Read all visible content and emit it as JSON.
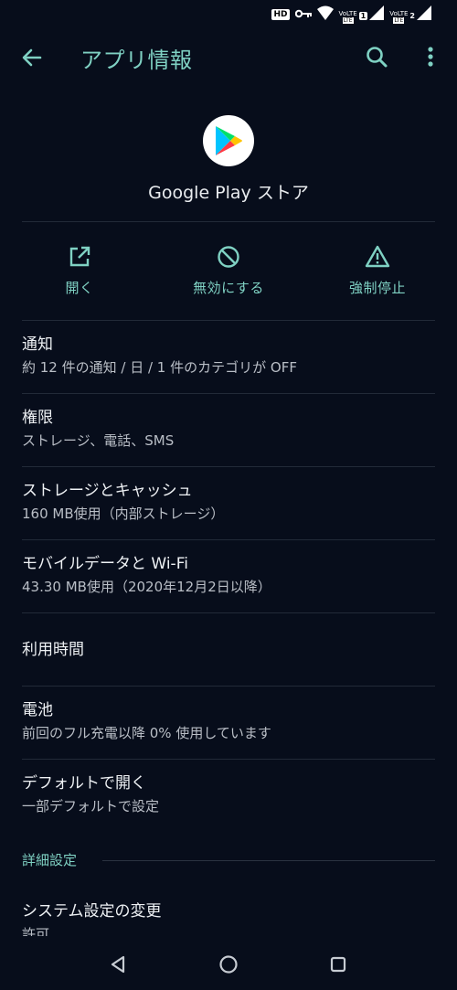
{
  "status_bar": {
    "icons": [
      "hd-badge-icon",
      "vpn-key-icon",
      "wifi-icon",
      "volte-lte-icon",
      "signal-icon",
      "volte-lte-icon",
      "signal-icon"
    ],
    "sim1": "1",
    "sim2": "2",
    "volte": "VoLTE",
    "lte": "LTE",
    "hd_badge": "HD"
  },
  "app_bar": {
    "title": "アプリ情報",
    "back_icon": "arrow-back-icon",
    "search_icon": "search-icon",
    "more_icon": "more-vert-icon"
  },
  "app": {
    "name": "Google Play ストア",
    "icon": "google-play-icon"
  },
  "actions": [
    {
      "label": "開く",
      "icon": "open-external-icon"
    },
    {
      "label": "無効にする",
      "icon": "block-icon"
    },
    {
      "label": "強制停止",
      "icon": "warning-icon"
    }
  ],
  "settings": [
    {
      "title": "通知",
      "summary": "約 12 件の通知 / 日 / 1 件のカテゴリが OFF"
    },
    {
      "title": "権限",
      "summary": "ストレージ、電話、SMS"
    },
    {
      "title": "ストレージとキャッシュ",
      "summary": "160 MB使用（内部ストレージ）"
    },
    {
      "title": "モバイルデータと Wi-Fi",
      "summary": "43.30 MB使用（2020年12月2日以降）"
    },
    {
      "title": "利用時間",
      "summary": ""
    },
    {
      "title": "電池",
      "summary": "前回のフル充電以降 0% 使用しています"
    },
    {
      "title": "デフォルトで開く",
      "summary": "一部デフォルトで設定"
    }
  ],
  "advanced": {
    "section_label": "詳細設定",
    "items": [
      {
        "title": "システム設定の変更",
        "summary": "許可"
      }
    ]
  },
  "nav": {
    "back_icon": "nav-back-icon",
    "home_icon": "nav-home-icon",
    "recents_icon": "nav-recents-icon"
  },
  "colors": {
    "background": "#070d1b",
    "accent": "#7fd1c3",
    "primary_text": "#eef1f4",
    "secondary_text": "#b9bec6"
  }
}
